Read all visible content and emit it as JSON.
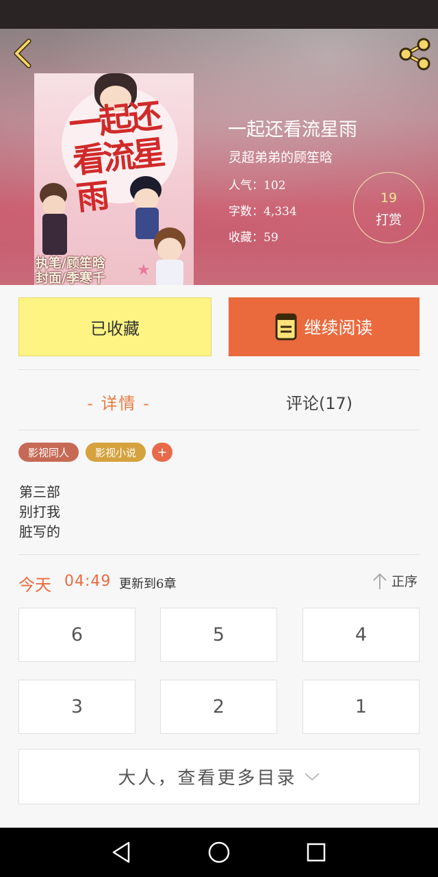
{
  "book": {
    "title": "一起还看流星雨",
    "author": "灵超弟弟的顾笙晗",
    "popularity": "人气：102",
    "word_count": "字数：4,334",
    "favorites": "收藏：59"
  },
  "cover": {
    "title": "一起还看流星雨",
    "credits": [
      "执笔/顾笙晗",
      "封面/季寒千"
    ]
  },
  "reward": {
    "count": "19",
    "label": "打赏"
  },
  "actions": {
    "favorited_label": "已收藏",
    "continue_label": "继续阅读"
  },
  "tabs": {
    "detail": "- 详情 -",
    "comments": "评论(17)"
  },
  "tags": [
    {
      "label": "影视同人",
      "color": "#c66a55"
    },
    {
      "label": "影视小说",
      "color": "#d5a23e"
    },
    {
      "label": "+",
      "color": "#e86a4a"
    }
  ],
  "description": [
    "第三部",
    "别打我",
    "脏写的"
  ],
  "update": {
    "today": "今天",
    "time": "04:49",
    "text": "更新到6章",
    "sort_label": "正序"
  },
  "chapters": [
    "6",
    "5",
    "4",
    "3",
    "2",
    "1"
  ],
  "more_label": "大人，查看更多目录",
  "colors": {
    "accent": "#ea6a3e",
    "favorite_bg": "#fdf483",
    "reward_num": "#f7e39a"
  }
}
